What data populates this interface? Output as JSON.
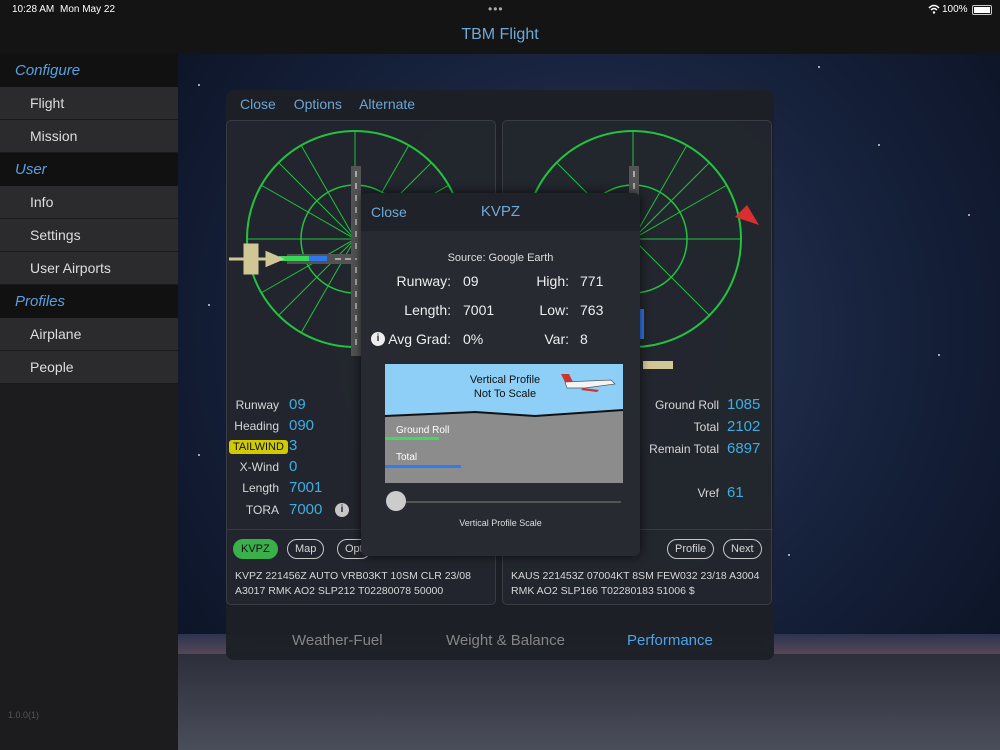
{
  "status": {
    "time": "10:28 AM",
    "date": "Mon May 22",
    "battery": "100%"
  },
  "app_title": "TBM Flight",
  "sidebar": {
    "sections": [
      {
        "title": "Configure",
        "items": [
          "Flight",
          "Mission"
        ]
      },
      {
        "title": "User",
        "items": [
          "Info",
          "Settings",
          "User Airports"
        ]
      },
      {
        "title": "Profiles",
        "items": [
          "Airplane",
          "People"
        ]
      }
    ],
    "version": "1.0.0(1)"
  },
  "panel": {
    "top_tabs": [
      "Close",
      "Options",
      "Alternate"
    ],
    "left": {
      "rows": [
        {
          "label": "Runway",
          "value": "09"
        },
        {
          "label": "Heading",
          "value": "090"
        },
        {
          "label": "TAILWIND",
          "value": "3"
        },
        {
          "label": "X-Wind",
          "value": "0"
        },
        {
          "label": "Length",
          "value": "7001"
        },
        {
          "label": "TORA",
          "value": "7000"
        }
      ],
      "pills": [
        "KVPZ",
        "Map",
        "Opt"
      ],
      "metar": "KVPZ 221456Z AUTO VRB03KT 10SM CLR 23/08 A3017 RMK AO2 SLP212 T02280078 50000"
    },
    "right": {
      "rows": [
        {
          "label": "Ground Roll",
          "value": "1085"
        },
        {
          "label": "Total",
          "value": "2102"
        },
        {
          "label": "Remain Total",
          "value": "6897"
        },
        {
          "label": "Vref",
          "value": "61"
        }
      ],
      "pills": [
        "Profile",
        "Next"
      ],
      "metar": "KAUS 221453Z 07004KT 8SM FEW032 23/18 A3004 RMK AO2 SLP166 T02280183 51006 $"
    },
    "bottom_tabs": [
      "Weather-Fuel",
      "Weight & Balance",
      "Performance"
    ],
    "active_tab": "Performance"
  },
  "modal": {
    "close": "Close",
    "title": "KVPZ",
    "source": "Source: Google Earth",
    "left_rows": [
      {
        "label": "Runway:",
        "value": "09"
      },
      {
        "label": "Length:",
        "value": "7001"
      },
      {
        "label": "Avg Grad:",
        "value": "0%"
      }
    ],
    "right_rows": [
      {
        "label": "High:",
        "value": "771"
      },
      {
        "label": "Low:",
        "value": "763"
      },
      {
        "label": "Var:",
        "value": "8"
      }
    ],
    "profile_title": "Vertical Profile",
    "profile_subtitle": "Not To Scale",
    "ground_roll_label": "Ground Roll",
    "total_label": "Total",
    "slider_label": "Vertical Profile Scale",
    "colors": {
      "ground_roll": "#3ddc5a",
      "total": "#2f7bf0",
      "sky": "#8ecff7",
      "terrain": "#8c8c8c"
    }
  }
}
